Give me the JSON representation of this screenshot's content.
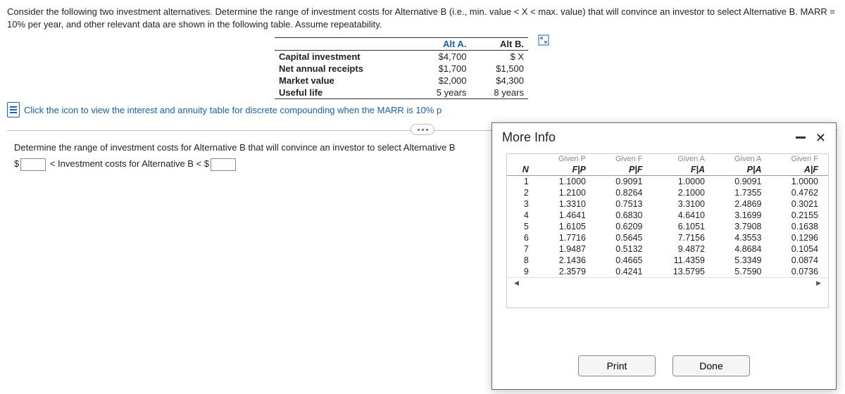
{
  "problem": {
    "text": "Consider the following two investment alternatives. Determine the range of investment costs for Alternative B (i.e., min. value < X < max. value) that will convince an investor to select Alternative B. MARR = 10% per year, and other relevant data are shown in the following table. Assume repeatability."
  },
  "data_table": {
    "col_a": "Alt A.",
    "col_b": "Alt B.",
    "rows": [
      {
        "label": "Capital investment",
        "a": "$4,700",
        "b": "$    X"
      },
      {
        "label": "Net annual receipts",
        "a": "$1,700",
        "b": "$1,500"
      },
      {
        "label": "Market value",
        "a": "$2,000",
        "b": "$4,300"
      },
      {
        "label": "Useful life",
        "a": "5 years",
        "b": "8 years"
      }
    ]
  },
  "link_text": "Click the icon to view the interest and annuity table for discrete compounding when the MARR is 10% p",
  "question": {
    "line1": "Determine the range of investment costs for Alternative B that will convince an investor to select Alternative B",
    "line2_pre": "$",
    "line2_mid": " < Investment costs for Alternative B < $"
  },
  "modal": {
    "title": "More Info",
    "print": "Print",
    "done": "Done",
    "headers_pre": [
      "",
      "Given P",
      "Given F",
      "Given A",
      "Given A",
      "Given F"
    ],
    "headers": [
      "N",
      "F|P",
      "P|F",
      "F|A",
      "P|A",
      "A|F"
    ],
    "rows": [
      {
        "n": "1",
        "fp": "1.1000",
        "pf": "0.9091",
        "fa": "1.0000",
        "pa": "0.9091",
        "af": "1.0000"
      },
      {
        "n": "2",
        "fp": "1.2100",
        "pf": "0.8264",
        "fa": "2.1000",
        "pa": "1.7355",
        "af": "0.4762"
      },
      {
        "n": "3",
        "fp": "1.3310",
        "pf": "0.7513",
        "fa": "3.3100",
        "pa": "2.4869",
        "af": "0.3021"
      },
      {
        "n": "4",
        "fp": "1.4641",
        "pf": "0.6830",
        "fa": "4.6410",
        "pa": "3.1699",
        "af": "0.2155"
      },
      {
        "n": "5",
        "fp": "1.6105",
        "pf": "0.6209",
        "fa": "6.1051",
        "pa": "3.7908",
        "af": "0.1638"
      },
      {
        "n": "6",
        "fp": "1.7716",
        "pf": "0.5645",
        "fa": "7.7156",
        "pa": "4.3553",
        "af": "0.1296"
      },
      {
        "n": "7",
        "fp": "1.9487",
        "pf": "0.5132",
        "fa": "9.4872",
        "pa": "4.8684",
        "af": "0.1054"
      },
      {
        "n": "8",
        "fp": "2.1436",
        "pf": "0.4665",
        "fa": "11.4359",
        "pa": "5.3349",
        "af": "0.0874"
      },
      {
        "n": "9",
        "fp": "2.3579",
        "pf": "0.4241",
        "fa": "13.5795",
        "pa": "5.7590",
        "af": "0.0736"
      }
    ]
  }
}
